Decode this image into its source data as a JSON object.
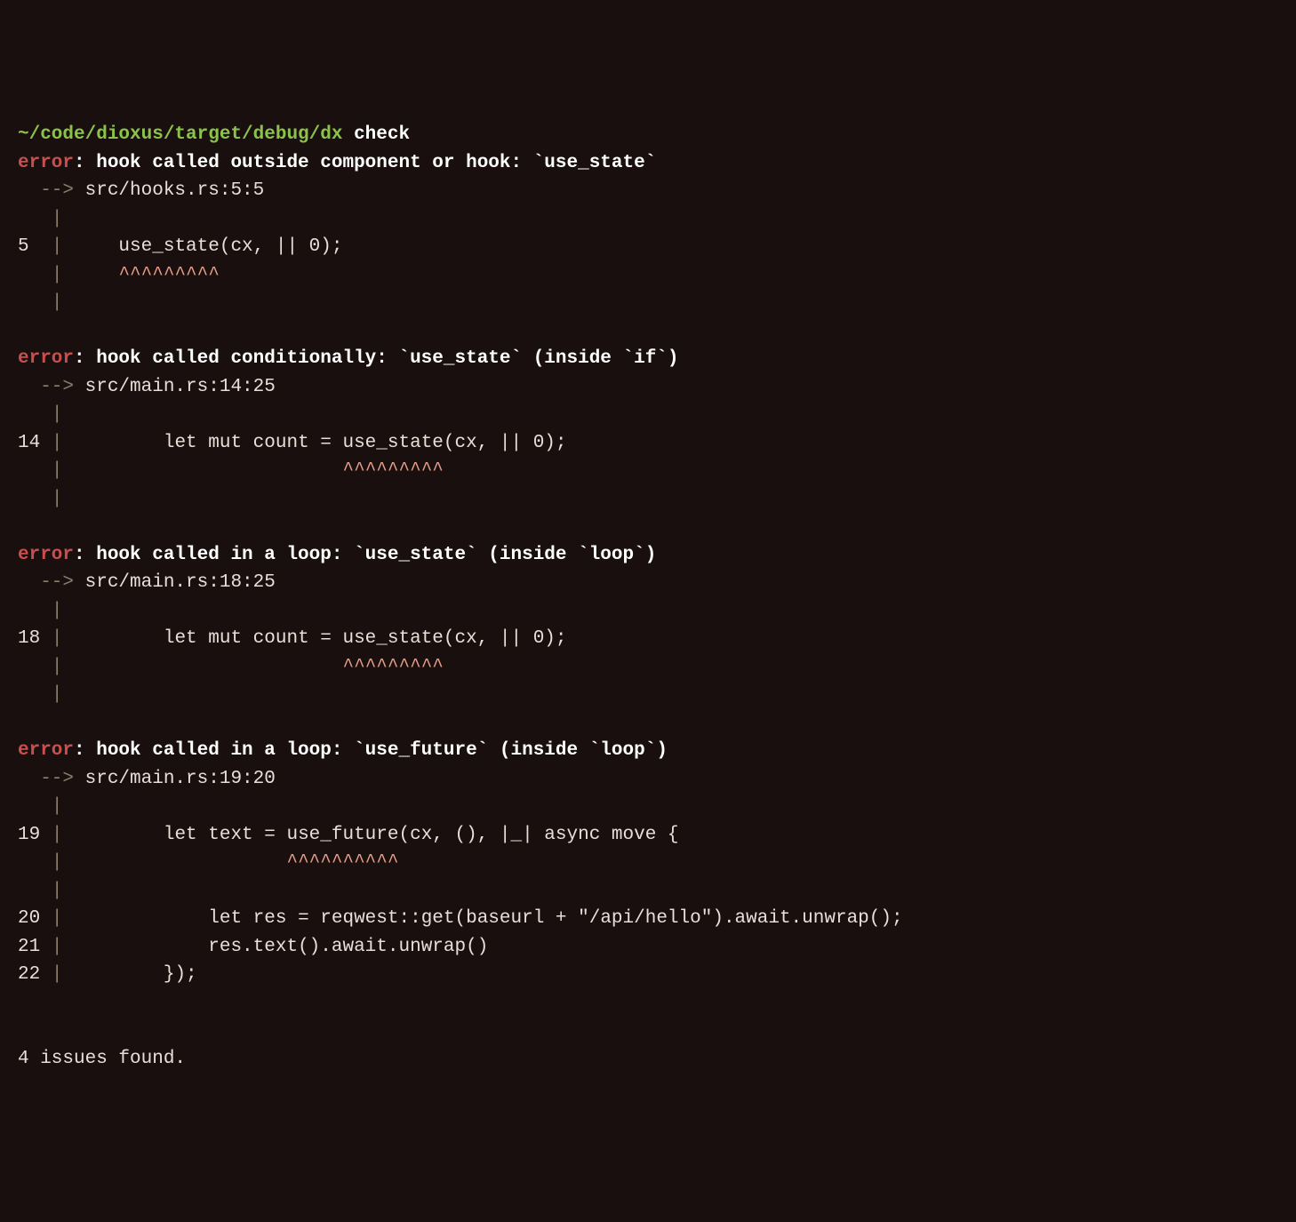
{
  "prompt": {
    "path": "~/code/dioxus/target/debug/dx",
    "command": "check"
  },
  "errors": [
    {
      "label": "error",
      "message": ": hook called outside component or hook: `use_state`",
      "arrow": "  -->",
      "location": " src/hooks.rs:5:5",
      "context": [
        {
          "prefix": "   ",
          "pipe": "|",
          "code": ""
        },
        {
          "prefix": "5  ",
          "pipe": "|",
          "code": "     use_state(cx, || 0);"
        },
        {
          "prefix": "   ",
          "pipe": "|",
          "code": "     ",
          "caret": "^^^^^^^^^"
        },
        {
          "prefix": "   ",
          "pipe": "|",
          "code": ""
        }
      ]
    },
    {
      "label": "error",
      "message": ": hook called conditionally: `use_state` (inside `if`)",
      "arrow": "  -->",
      "location": " src/main.rs:14:25",
      "context": [
        {
          "prefix": "   ",
          "pipe": "|",
          "code": ""
        },
        {
          "prefix": "14 ",
          "pipe": "|",
          "code": "         let mut count = use_state(cx, || 0);"
        },
        {
          "prefix": "   ",
          "pipe": "|",
          "code": "                         ",
          "caret": "^^^^^^^^^"
        },
        {
          "prefix": "   ",
          "pipe": "|",
          "code": ""
        }
      ]
    },
    {
      "label": "error",
      "message": ": hook called in a loop: `use_state` (inside `loop`)",
      "arrow": "  -->",
      "location": " src/main.rs:18:25",
      "context": [
        {
          "prefix": "   ",
          "pipe": "|",
          "code": ""
        },
        {
          "prefix": "18 ",
          "pipe": "|",
          "code": "         let mut count = use_state(cx, || 0);"
        },
        {
          "prefix": "   ",
          "pipe": "|",
          "code": "                         ",
          "caret": "^^^^^^^^^"
        },
        {
          "prefix": "   ",
          "pipe": "|",
          "code": ""
        }
      ]
    },
    {
      "label": "error",
      "message": ": hook called in a loop: `use_future` (inside `loop`)",
      "arrow": "  -->",
      "location": " src/main.rs:19:20",
      "context": [
        {
          "prefix": "   ",
          "pipe": "|",
          "code": ""
        },
        {
          "prefix": "19 ",
          "pipe": "|",
          "code": "         let text = use_future(cx, (), |_| async move {"
        },
        {
          "prefix": "   ",
          "pipe": "|",
          "code": "                    ",
          "caret": "^^^^^^^^^^"
        },
        {
          "prefix": "   ",
          "pipe": "|",
          "code": ""
        },
        {
          "prefix": "20 ",
          "pipe": "|",
          "code": "             let res = reqwest::get(baseurl + \"/api/hello\").await.unwrap();"
        },
        {
          "prefix": "21 ",
          "pipe": "|",
          "code": "             res.text().await.unwrap()"
        },
        {
          "prefix": "22 ",
          "pipe": "|",
          "code": "         });"
        }
      ]
    }
  ],
  "summary": "4 issues found."
}
